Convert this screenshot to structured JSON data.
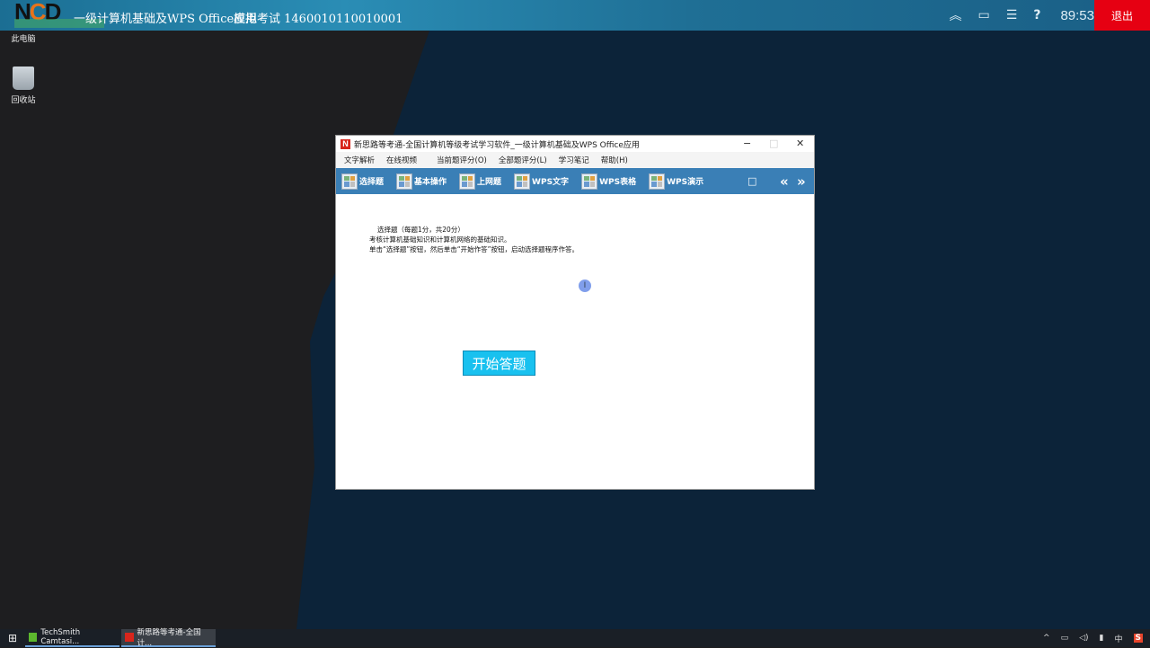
{
  "topbar": {
    "title": "一级计算机基础及WPS Office应用",
    "exam": "模拟考试 1460010110010001",
    "timer": "89:53",
    "exit_label": "退出",
    "logo_text": "NCD Examination"
  },
  "desktop": {
    "icons": [
      {
        "label": "此电脑"
      },
      {
        "label": "回收站"
      }
    ]
  },
  "window": {
    "title": "新思路等考通-全国计算机等级考试学习软件_一级计算机基础及WPS Office应用",
    "menu": [
      "文字解析",
      "在线视频",
      "当前题评分(O)",
      "全部题评分(L)",
      "学习笔记",
      "帮助(H)"
    ],
    "tools": [
      "选择题",
      "基本操作",
      "上网题",
      "WPS文字",
      "WPS表格",
      "WPS演示"
    ],
    "content": {
      "line1": "选择题（每题1分，共20分）",
      "line2": "考核计算机基础知识和计算机网络的基础知识。",
      "line3": "单击“选择题”按钮，然后单击“开始作答”按钮，启动选择题程序作答。"
    },
    "start_label": "开始答题"
  },
  "taskbar": {
    "items": [
      "TechSmith Camtasi...",
      "新思路等考通-全国计..."
    ],
    "ime": "中"
  },
  "colors": {
    "toolbar": "#3a7fb6",
    "start_button": "#19c1ef",
    "exit": "#e60012"
  }
}
